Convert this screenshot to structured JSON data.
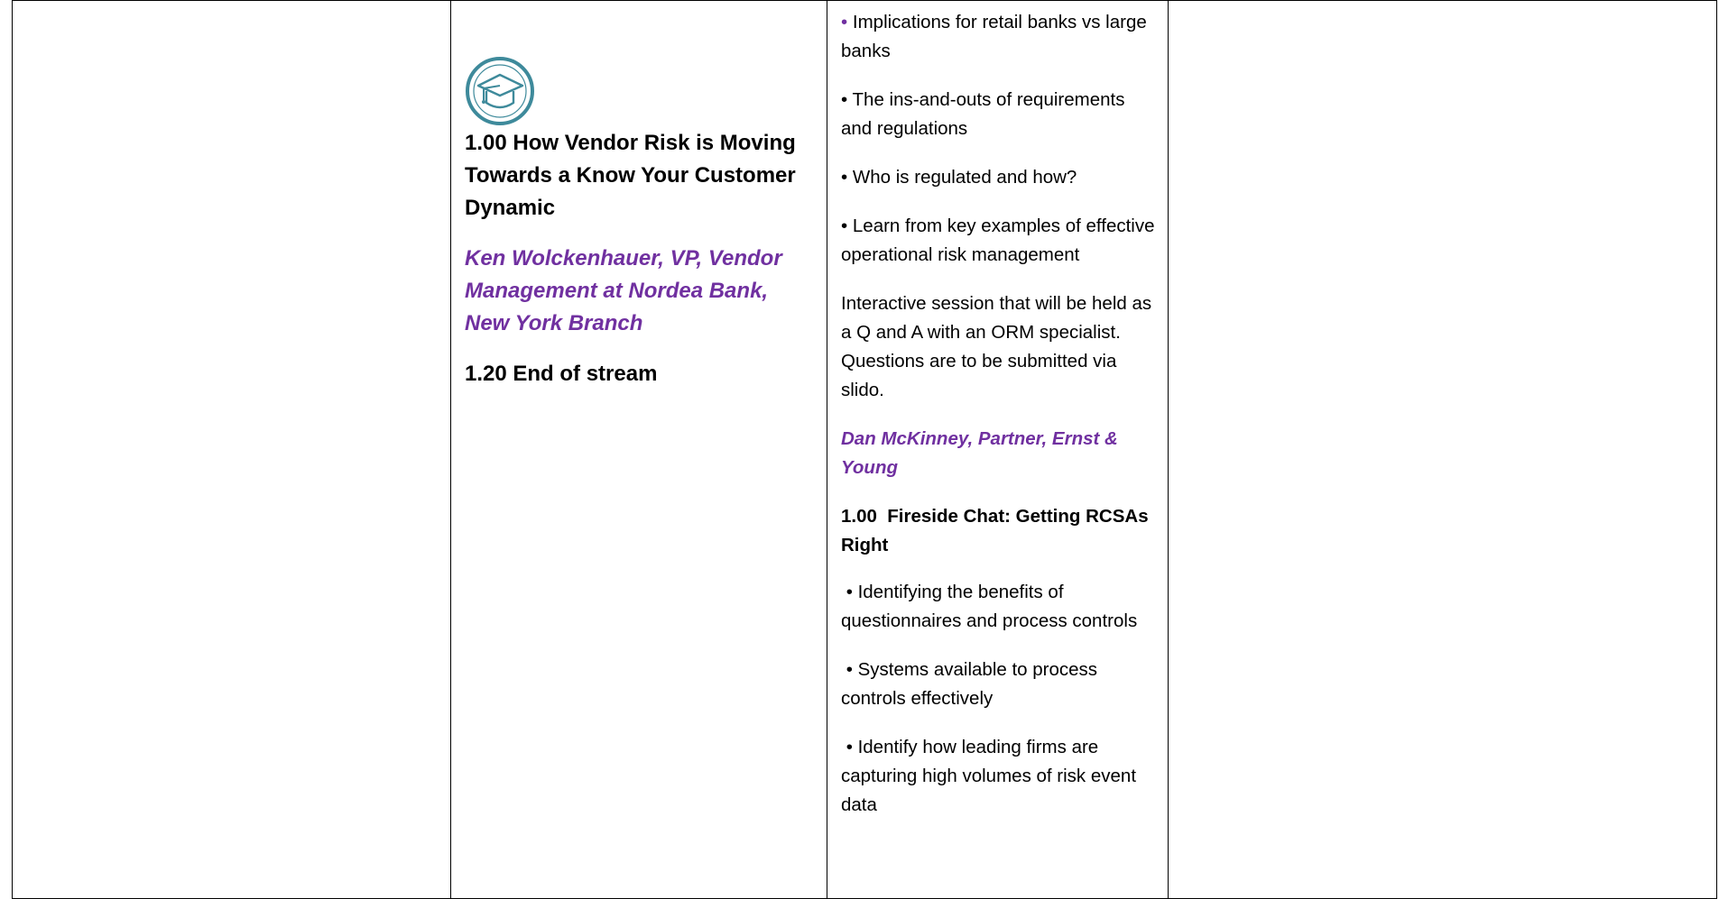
{
  "column_2": {
    "session_title": "1.00 How Vendor Risk is Moving Towards a Know Your Customer Dynamic",
    "speaker": "Ken Wolckenhauer, VP, Vendor Management at Nordea Bank, New York Branch",
    "end_note": "1.20 End of stream",
    "icon": "graduation-cap-icon"
  },
  "column_3": {
    "bullets_top": [
      {
        "bullet": "•",
        "text": "Implications for retail banks vs large banks"
      },
      {
        "bullet": "•",
        "text": "The ins-and-outs of requirements and regulations"
      },
      {
        "bullet": "•",
        "text": "Who is regulated and how?"
      },
      {
        "bullet": "•",
        "text": "Learn from key examples of effective operational risk management"
      }
    ],
    "interactive_note": "Interactive session that will be held as a Q and A with an ORM specialist. Questions are to be submitted via slido.",
    "speaker": "Dan McKinney, Partner, Ernst & Young",
    "session_title": "1.00  Fireside Chat: Getting RCSAs Right",
    "bullets_bottom": [
      " • Identifying the benefits of questionnaires and process controls",
      " • Systems available to process controls effectively",
      " • Identify how leading firms are capturing high volumes of risk event data"
    ]
  },
  "colors": {
    "speaker": "#7030a0",
    "icon": "#3e8a9b",
    "border": "#000000"
  }
}
